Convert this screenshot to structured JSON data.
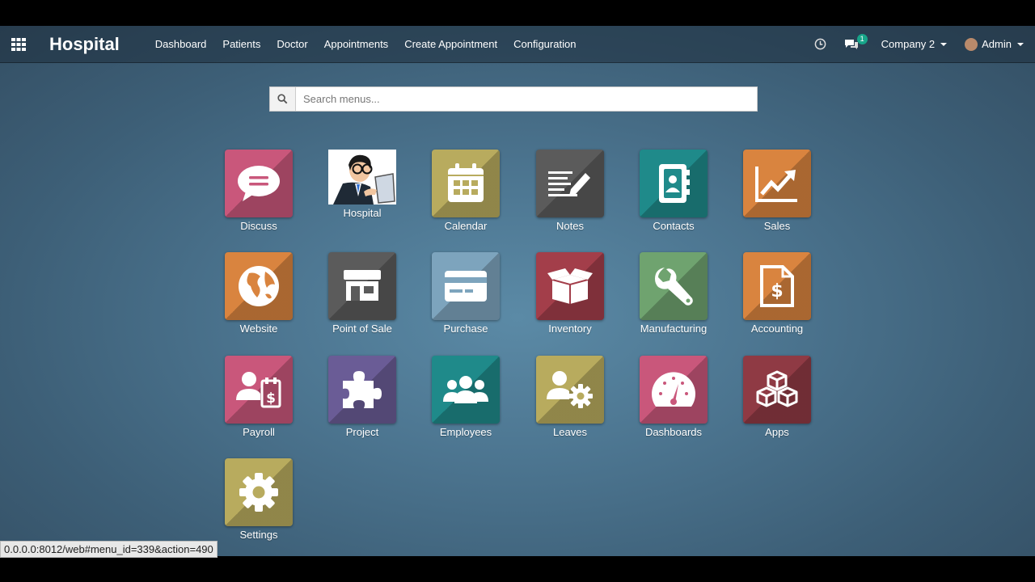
{
  "navbar": {
    "brand": "Hospital",
    "menu": [
      "Dashboard",
      "Patients",
      "Doctor",
      "Appointments",
      "Create Appointment",
      "Configuration"
    ],
    "messages_count": "1",
    "company": "Company 2",
    "user": "Admin"
  },
  "search": {
    "placeholder": "Search menus..."
  },
  "apps": [
    {
      "label": "Discuss",
      "icon": "chat-bubble-icon",
      "color": "#c9577b"
    },
    {
      "label": "Hospital",
      "icon": "doctor-illustration",
      "color": "#ffffff"
    },
    {
      "label": "Calendar",
      "icon": "calendar-icon",
      "color": "#b8ab5e"
    },
    {
      "label": "Notes",
      "icon": "notes-pencil-icon",
      "color": "#5b5b5b"
    },
    {
      "label": "Contacts",
      "icon": "address-book-icon",
      "color": "#1f8a8a"
    },
    {
      "label": "Sales",
      "icon": "trend-chart-icon",
      "color": "#d9843f"
    },
    {
      "label": "Website",
      "icon": "globe-icon",
      "color": "#d9843f"
    },
    {
      "label": "Point of Sale",
      "icon": "shop-icon",
      "color": "#5b5b5b"
    },
    {
      "label": "Purchase",
      "icon": "credit-card-icon",
      "color": "#7da4bd"
    },
    {
      "label": "Inventory",
      "icon": "open-box-icon",
      "color": "#a33e4a"
    },
    {
      "label": "Manufacturing",
      "icon": "wrench-icon",
      "color": "#6fa36f"
    },
    {
      "label": "Accounting",
      "icon": "invoice-dollar-icon",
      "color": "#d9843f"
    },
    {
      "label": "Payroll",
      "icon": "employee-payslip-icon",
      "color": "#c9577b"
    },
    {
      "label": "Project",
      "icon": "puzzle-piece-icon",
      "color": "#6a5c96"
    },
    {
      "label": "Employees",
      "icon": "users-group-icon",
      "color": "#1f8a8a"
    },
    {
      "label": "Leaves",
      "icon": "user-gear-icon",
      "color": "#b8ab5e"
    },
    {
      "label": "Dashboards",
      "icon": "gauge-icon",
      "color": "#c9577b"
    },
    {
      "label": "Apps",
      "icon": "cubes-icon",
      "color": "#8f3a44"
    },
    {
      "label": "Settings",
      "icon": "gear-icon",
      "color": "#b8ab5e"
    }
  ],
  "status_bar": {
    "url": "0.0.0.0:8012/web#menu_id=339&action=490"
  }
}
